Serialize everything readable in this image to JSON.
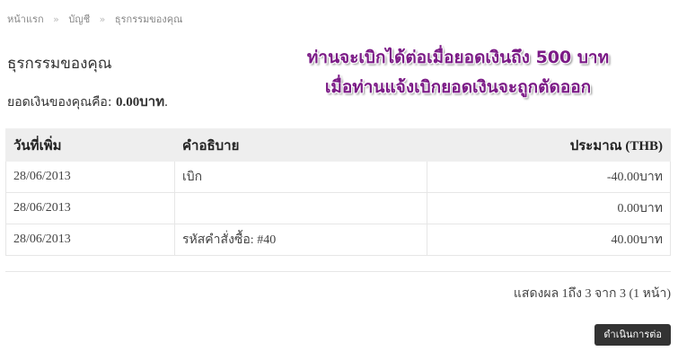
{
  "breadcrumb": {
    "items": [
      {
        "label": "หน้าแรก"
      },
      {
        "label": "บัญชี"
      },
      {
        "label": "ธุรกรรมของคุณ"
      }
    ],
    "separator": "»"
  },
  "page": {
    "title": "ธุรกรรมของคุณ"
  },
  "notice": {
    "line1": "ท่านจะเบิกได้ต่อเมื่อยอดเงินถึง 500 บาท",
    "line2": "เมื่อท่านแจ้งเบิกยอดเงินจะถูกตัดออก",
    "color": "#7b1a86"
  },
  "balance": {
    "label": "ยอดเงินของคุณคือ: ",
    "value": "0.00บาท",
    "suffix": "."
  },
  "table": {
    "headers": {
      "date": "วันที่เพิ่ม",
      "description": "คำอธิบาย",
      "amount": "ประมาณ (THB)"
    },
    "rows": [
      {
        "date": "28/06/2013",
        "description": "เบิก",
        "amount": "-40.00บาท"
      },
      {
        "date": "28/06/2013",
        "description": "",
        "amount": "0.00บาท"
      },
      {
        "date": "28/06/2013",
        "description": "รหัสคำสั่งซื้อ: #40",
        "amount": "40.00บาท"
      }
    ]
  },
  "pagination": {
    "text": "แสดงผล 1ถึง 3 จาก 3 (1 หน้า)"
  },
  "actions": {
    "continue_label": "ดำเนินการต่อ"
  }
}
